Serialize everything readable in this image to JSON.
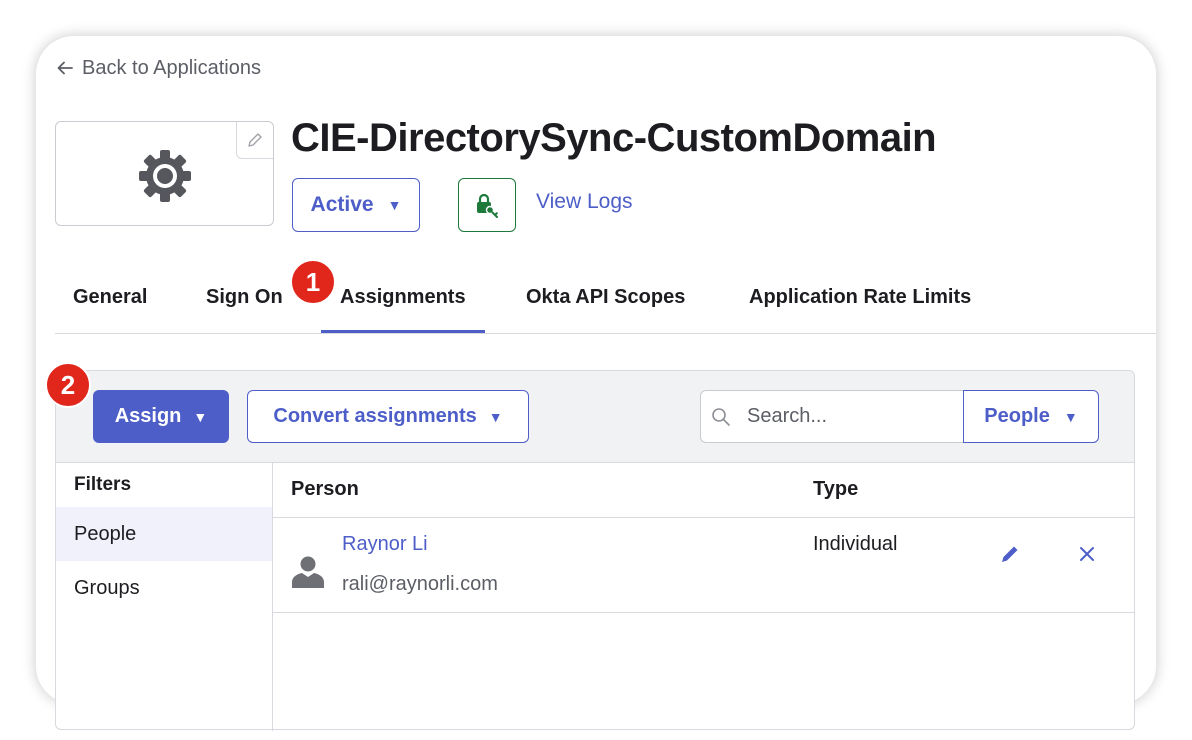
{
  "nav": {
    "back_label": "Back to Applications"
  },
  "app": {
    "title": "CIE-DirectorySync-CustomDomain",
    "status_label": "Active",
    "view_logs_label": "View Logs"
  },
  "tabs": [
    {
      "label": "General"
    },
    {
      "label": "Sign On"
    },
    {
      "label": "Assignments",
      "active": true
    },
    {
      "label": "Okta API Scopes"
    },
    {
      "label": "Application Rate Limits"
    }
  ],
  "callouts": [
    "1",
    "2"
  ],
  "toolbar": {
    "assign_label": "Assign",
    "convert_label": "Convert assignments",
    "search_placeholder": "Search...",
    "search_value": "",
    "filter_select": "People"
  },
  "filters": {
    "title": "Filters",
    "items": [
      {
        "label": "People",
        "selected": true
      },
      {
        "label": "Groups",
        "selected": false
      }
    ]
  },
  "table": {
    "columns": [
      "Person",
      "Type"
    ],
    "rows": [
      {
        "name": "Raynor Li",
        "email": "rali@raynorli.com",
        "type": "Individual"
      }
    ]
  },
  "colors": {
    "accent": "#4d5ec8",
    "callout": "#e1261c",
    "push_green": "#1e7a3b",
    "text": "#1d1d21"
  }
}
